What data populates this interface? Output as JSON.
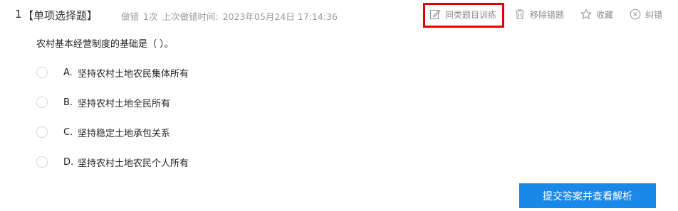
{
  "question": {
    "number": "1",
    "type_label": "【单项选择题】",
    "meta": {
      "wrong_label": "做错",
      "wrong_count": "1次",
      "last_wrong_label": "上次做错时间:",
      "last_wrong_time": "2023年05月24日 17:14:36"
    },
    "stem": "农村基本经营制度的基础是（  ）。",
    "options": [
      {
        "letter": "A.",
        "text": "坚持农村土地农民集体所有"
      },
      {
        "letter": "B.",
        "text": "坚持农村土地全民所有"
      },
      {
        "letter": "C.",
        "text": "坚持稳定土地承包关系"
      },
      {
        "letter": "D.",
        "text": "坚持农村土地农民个人所有"
      }
    ]
  },
  "actions": {
    "similar_training": {
      "label": "同类题目训练",
      "icon": "edit-note-icon"
    },
    "remove_wrong": {
      "label": "移除错题",
      "icon": "trash-icon"
    },
    "favorite": {
      "label": "收藏",
      "icon": "star-icon"
    },
    "report_error": {
      "label": "纠错",
      "icon": "circle-x-icon"
    }
  },
  "submit_button": {
    "label": "提交答案并查看解析"
  },
  "colors": {
    "highlight": "#e00000",
    "primary": "#1a88e8",
    "muted": "#999999"
  }
}
